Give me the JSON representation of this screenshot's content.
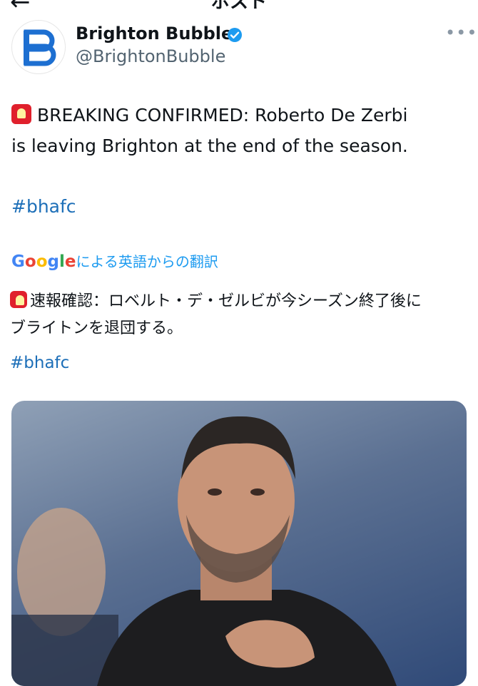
{
  "header": {
    "title": "ポスト",
    "back_icon": "arrow-left-icon"
  },
  "author": {
    "name": "Brighton Bubble",
    "handle": "@BrightonBubble",
    "verified": true,
    "verified_color": "#1d9bf0",
    "avatar_color": "#1d6fd1"
  },
  "tweet": {
    "text_line1": "BREAKING CONFIRMED: Roberto De Zerbi",
    "text_line2": "is leaving Brighton at the end of the season.",
    "hashtag": "#bhafc"
  },
  "translation": {
    "provider": "Google",
    "label": "による英語からの翻訳",
    "text_line1": "速報確認：ロベルト・デ・ゼルビが今シーズン終了後に",
    "text_line2": "ブライトンを退団する。",
    "hashtag": "#bhafc"
  },
  "colors": {
    "link": "#1d6fb8",
    "text": "#0f1419",
    "secondary": "#536471"
  }
}
